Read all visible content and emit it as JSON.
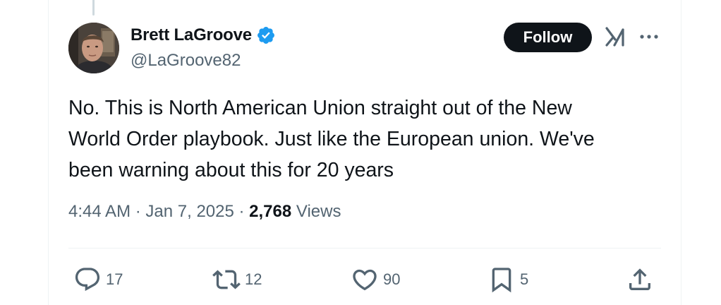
{
  "author": {
    "display_name": "Brett LaGroove",
    "handle": "@LaGroove82",
    "verified": true
  },
  "header_actions": {
    "follow_label": "Follow",
    "grok_icon": "grok-icon",
    "more_icon": "more-icon"
  },
  "tweet": {
    "text": "No. This is North American Union straight out of the New\nWorld Order playbook. Just like the European union. We've\nbeen warning about this for 20 years",
    "time": "4:44 AM",
    "separator": " · ",
    "date": "Jan 7, 2025",
    "views_count": "2,768",
    "views_label": " Views"
  },
  "actions": {
    "reply_count": "17",
    "retweet_count": "12",
    "like_count": "90",
    "bookmark_count": "5"
  },
  "colors": {
    "text": "#0f1419",
    "secondary": "#536471",
    "verified_blue": "#1d9bf0",
    "follow_bg": "#0f1419"
  }
}
